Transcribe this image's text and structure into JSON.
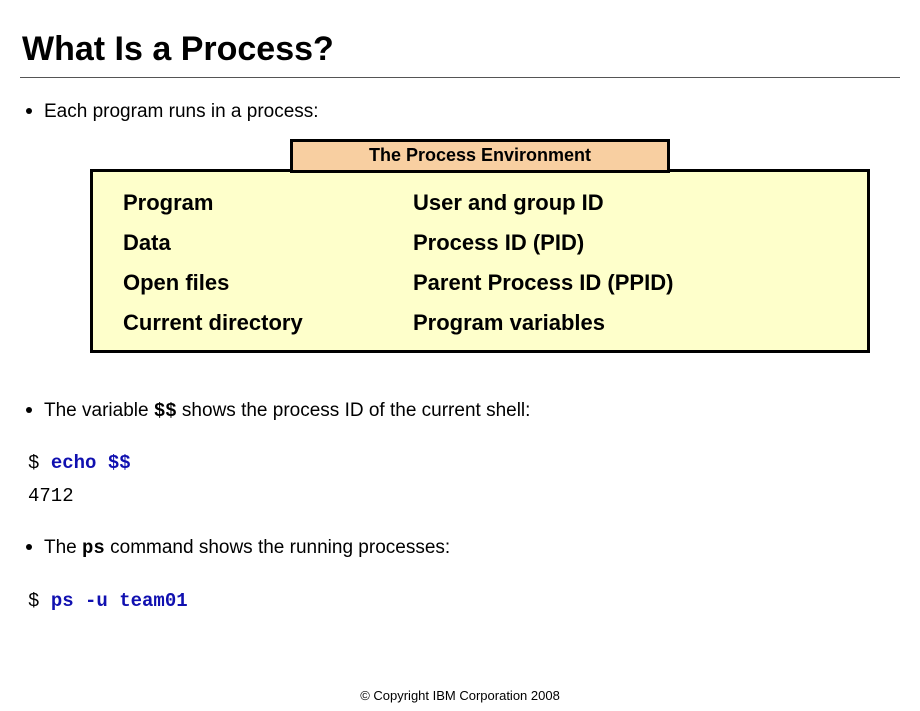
{
  "title": "What Is a Process?",
  "bullets": {
    "b1_prefix": "Each program runs in a process:",
    "b2_prefix": "The variable ",
    "b2_code": "$$",
    "b2_suffix": " shows the process ID of the current shell:",
    "b3_prefix": "The ",
    "b3_code": "ps",
    "b3_suffix": " command shows the running processes:"
  },
  "env": {
    "header": "The Process Environment",
    "rows": [
      {
        "left": "Program",
        "right": "User and group ID"
      },
      {
        "left": "Data",
        "right": "Process ID (PID)"
      },
      {
        "left": "Open files",
        "right": "Parent Process ID (PPID)"
      },
      {
        "left": "Current directory",
        "right": "Program variables"
      }
    ]
  },
  "code1": {
    "prompt": "$ ",
    "cmd": "echo $$",
    "output": "4712"
  },
  "code2": {
    "prompt": "$ ",
    "cmd": "ps -u team01"
  },
  "footer": "© Copyright IBM Corporation 2008"
}
